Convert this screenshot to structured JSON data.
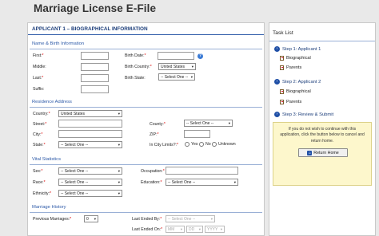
{
  "page": {
    "title": "Marriage License E-File"
  },
  "form": {
    "title": "APPLICANT 1 – BIOGRAPHICAL INFORMATION",
    "sections": {
      "name_birth": "Name & Birth Information",
      "residence": "Residence Address",
      "vital": "Vital Statistics",
      "marriage": "Marriage History"
    },
    "labels": {
      "first": "First:",
      "middle": "Middle:",
      "last": "Last:",
      "suffix": "Suffix:",
      "birth_date": "Birth Date:",
      "birth_country": "Birth Country:",
      "birth_state": "Birth State:",
      "country": "Country:",
      "street": "Street:",
      "city": "City:",
      "state": "State:",
      "county": "County:",
      "zip": "ZIP:",
      "in_city_limits": "In City Limits?:",
      "sex": "Sex:",
      "race": "Race:",
      "ethnicity": "Ethnicity:",
      "occupation": "Occupation:",
      "education": "Education:",
      "previous_marriages": "Previous Marriages:",
      "last_ended_by": "Last Ended By:",
      "last_ended_on": "Last Ended On:"
    },
    "required_mark": "*",
    "values": {
      "birth_country": "United States",
      "birth_state": "-- Select One --",
      "country": "United States",
      "county": "-- Select One --",
      "state": "-- Select One --",
      "sex": "-- Select One --",
      "race": "-- Select One --",
      "ethnicity": "-- Select One --",
      "education": "-- Select One --",
      "previous_marriages": "0",
      "last_ended_by": "-- Select One --",
      "last_ended_on_mm": "MM",
      "last_ended_on_dd": "DD",
      "last_ended_on_yyyy": "YYYY"
    },
    "radio": {
      "yes": "Yes",
      "no": "No",
      "unknown": "Unknown"
    },
    "help_glyph": "?"
  },
  "tasks": {
    "title": "Task List",
    "step1": "Step 1: Applicant 1",
    "step1_items": [
      "Biographical",
      "Parents"
    ],
    "step2": "Step 2: Applicant 2",
    "step2_items": [
      "Biographical",
      "Parents"
    ],
    "step3": "Step 3: Review & Submit",
    "note": "If you do not wish to continue with this application, click the button below to cancel and return home.",
    "return_button": "Return Home"
  },
  "colors": {
    "accent": "#1f4fa6",
    "note_bg": "#fdf7cc",
    "required": "#dd0000"
  }
}
